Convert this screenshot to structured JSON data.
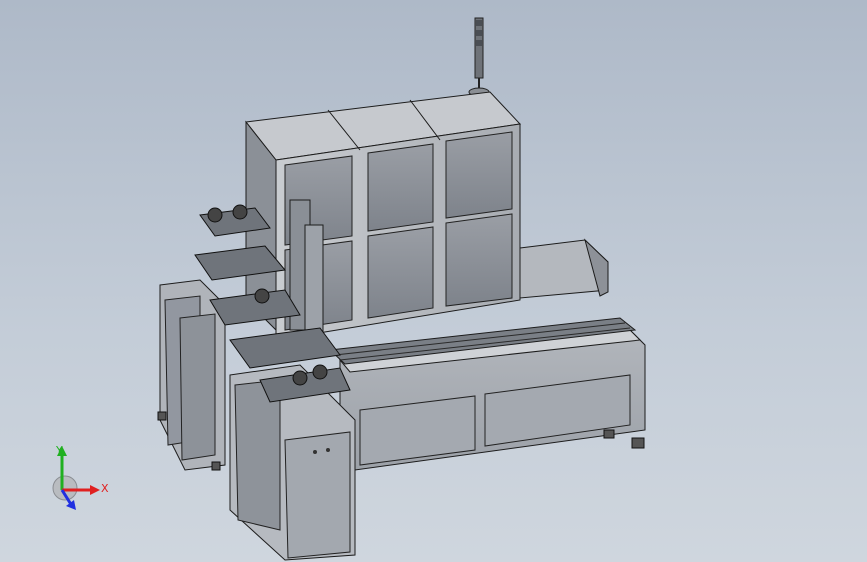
{
  "viewport": {
    "background_top": "#aeb9c8",
    "background_bottom": "#cfd6de"
  },
  "model": {
    "frame_color": "#b8bcc2",
    "panel_color": "#8e939b",
    "edge_color": "#1c1c1c"
  },
  "triad": {
    "x_label": "X",
    "y_label": "Y",
    "x_color": "#e02020",
    "y_color": "#20b020",
    "z_color": "#2030e0"
  }
}
